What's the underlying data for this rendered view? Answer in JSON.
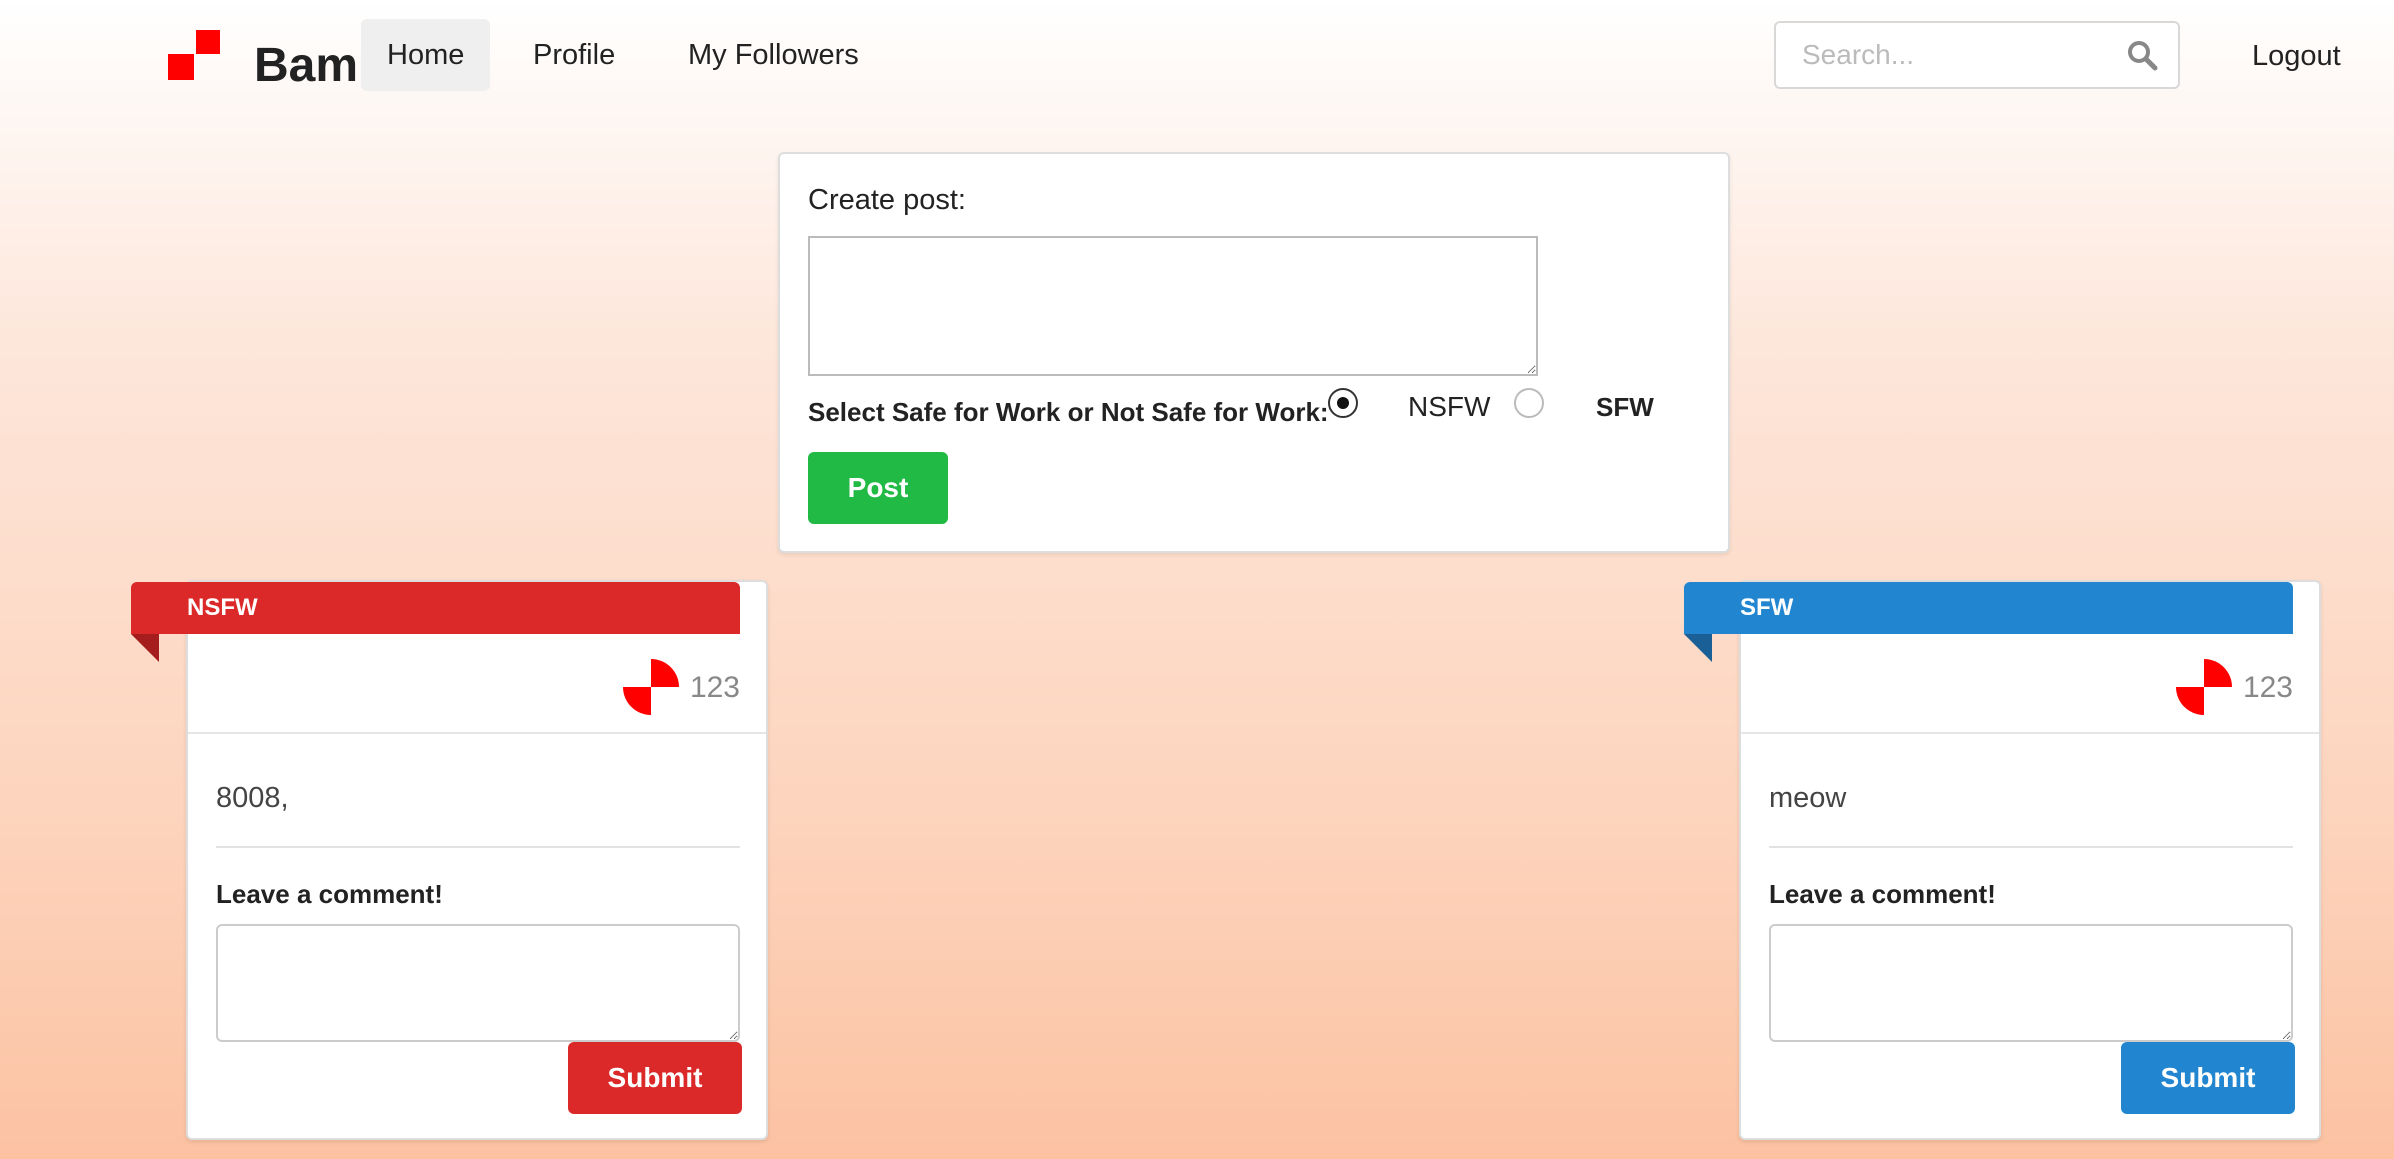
{
  "nav": {
    "brand": "Bam",
    "items": [
      {
        "label": "Home",
        "active": true
      },
      {
        "label": "Profile",
        "active": false
      },
      {
        "label": "My Followers",
        "active": false
      }
    ],
    "search_placeholder": "Search...",
    "logout_label": "Logout"
  },
  "create_post": {
    "label": "Create post:",
    "textarea_value": "",
    "select_label": "Select Safe for Work or Not Safe for Work:",
    "options": [
      {
        "label": "NSFW",
        "checked": true
      },
      {
        "label": "SFW",
        "checked": false
      }
    ],
    "post_button": "Post"
  },
  "posts": [
    {
      "tag": "NSFW",
      "tag_color": "#db2828",
      "likes": "123",
      "body": "8008,",
      "comment_label": "Leave a comment!",
      "comment_value": "",
      "submit_label": "Submit"
    },
    {
      "tag": "SFW",
      "tag_color": "#2185d0",
      "likes": "123",
      "body": "meow",
      "comment_label": "Leave a comment!",
      "comment_value": "",
      "submit_label": "Submit"
    }
  ],
  "colors": {
    "brand_red": "#ff0000",
    "post_green": "#21ba45",
    "nsfw_red": "#db2828",
    "sfw_blue": "#2185d0"
  }
}
